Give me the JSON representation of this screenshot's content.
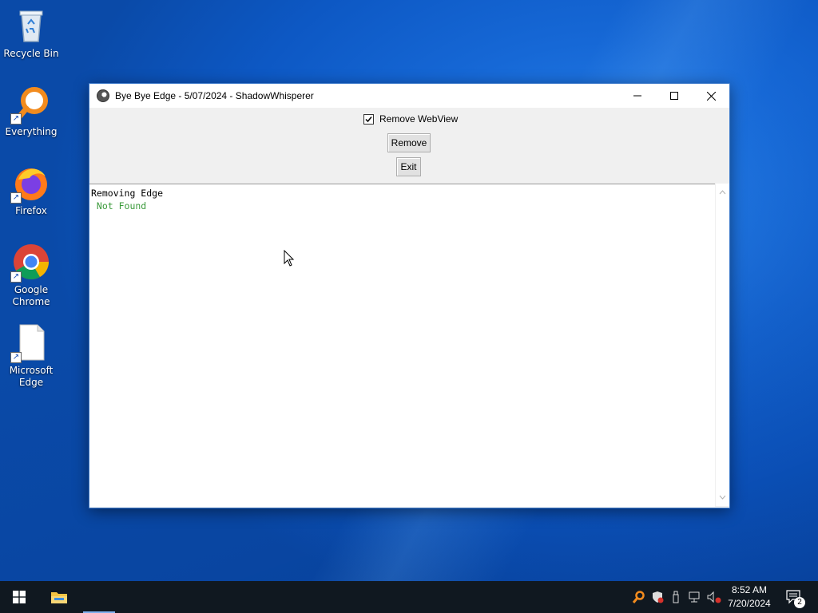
{
  "desktop": {
    "icons": [
      {
        "label": "Recycle Bin",
        "icon": "recycle-bin-icon"
      },
      {
        "label": "Everything",
        "icon": "everything-search-icon"
      },
      {
        "label": "Firefox",
        "icon": "firefox-icon"
      },
      {
        "label": "Google Chrome",
        "icon": "chrome-icon"
      },
      {
        "label": "Microsoft Edge",
        "icon": "blank-file-icon"
      }
    ]
  },
  "window": {
    "title": "Bye Bye Edge - 5/07/2024 - ShadowWhisperer",
    "checkbox": {
      "label": "Remove WebView",
      "checked": true
    },
    "remove_button": "Remove",
    "exit_button": "Exit",
    "output": {
      "line1": "Removing Edge",
      "line2": " Not Found",
      "line2_color": "#3a9a3a"
    }
  },
  "taskbar": {
    "time": "8:52 AM",
    "date": "7/20/2024",
    "notification_count": "2"
  },
  "colors": {
    "accent": "#0b5fd0",
    "taskbar": "#101820"
  }
}
